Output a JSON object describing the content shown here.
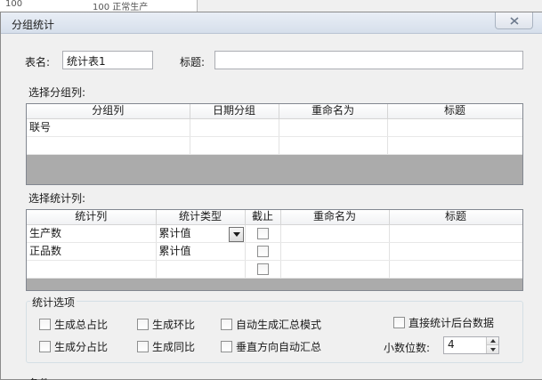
{
  "background_window": {
    "col1": "100",
    "col2": "100  正常生产"
  },
  "dialog": {
    "title": "分组统计"
  },
  "form": {
    "table_name_label": "表名:",
    "table_name_value": "统计表1",
    "title_label": "标题:",
    "title_value": ""
  },
  "group_section": {
    "label": "选择分组列:",
    "headers": [
      "分组列",
      "日期分组",
      "重命名为",
      "标题"
    ],
    "rows": [
      [
        "联号",
        "",
        "",
        ""
      ],
      [
        "",
        "",
        "",
        ""
      ]
    ]
  },
  "stat_section": {
    "label": "选择统计列:",
    "headers": [
      "统计列",
      "统计类型",
      "截止",
      "重命名为",
      "标题"
    ],
    "rows": [
      {
        "col": "生产数",
        "type": "累计值",
        "cutoff": false,
        "rename": "",
        "title": ""
      },
      {
        "col": "正品数",
        "type": "累计值",
        "cutoff": false,
        "rename": "",
        "title": ""
      },
      {
        "col": "",
        "type": "",
        "cutoff": false,
        "rename": "",
        "title": ""
      }
    ]
  },
  "options": {
    "title": "统计选项",
    "total_ratio": "生成总占比",
    "ring_ratio": "生成环比",
    "auto_summary": "自动生成汇总模式",
    "direct_backend": "直接统计后台数据",
    "sub_ratio": "生成分占比",
    "yoy_ratio": "生成同比",
    "vertical_summary": "垂直方向自动汇总",
    "decimal_label": "小数位数:",
    "decimal_value": "4"
  },
  "bottom_partial_label": "条件"
}
